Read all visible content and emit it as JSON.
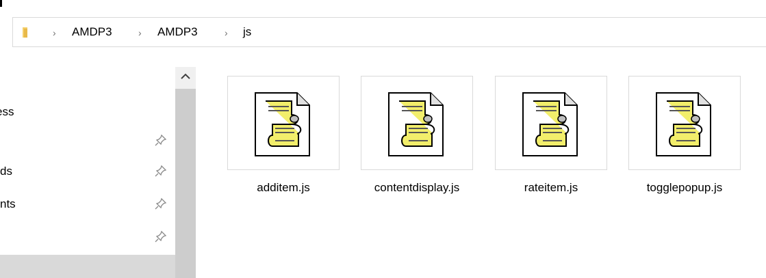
{
  "breadcrumb": {
    "folder_icon": "folder-icon",
    "separator_icon": "chevron-right-icon",
    "items": [
      "AMDP3",
      "AMDP3",
      "js"
    ]
  },
  "nav_pane": {
    "items": [
      {
        "label": "ess",
        "pinned": false
      },
      {
        "label": "",
        "pinned": true
      },
      {
        "label": "ds",
        "pinned": true
      },
      {
        "label": "nts",
        "pinned": true
      },
      {
        "label": "",
        "pinned": true
      }
    ],
    "pin_icon": "pin-icon"
  },
  "scrollbar": {
    "up_icon": "scroll-up-arrow-icon"
  },
  "files": [
    {
      "name": "additem.js",
      "icon": "js-script-file-icon"
    },
    {
      "name": "contentdisplay.js",
      "icon": "js-script-file-icon"
    },
    {
      "name": "rateitem.js",
      "icon": "js-script-file-icon"
    },
    {
      "name": "togglepopup.js",
      "icon": "js-script-file-icon"
    }
  ],
  "colors": {
    "folder": "#e8b94a",
    "selection": "#d9d9d9",
    "scroll_thumb": "#cdcdcd",
    "scroll_track": "#f0f0f0",
    "scroll_yellow": "#f2ee6b"
  }
}
